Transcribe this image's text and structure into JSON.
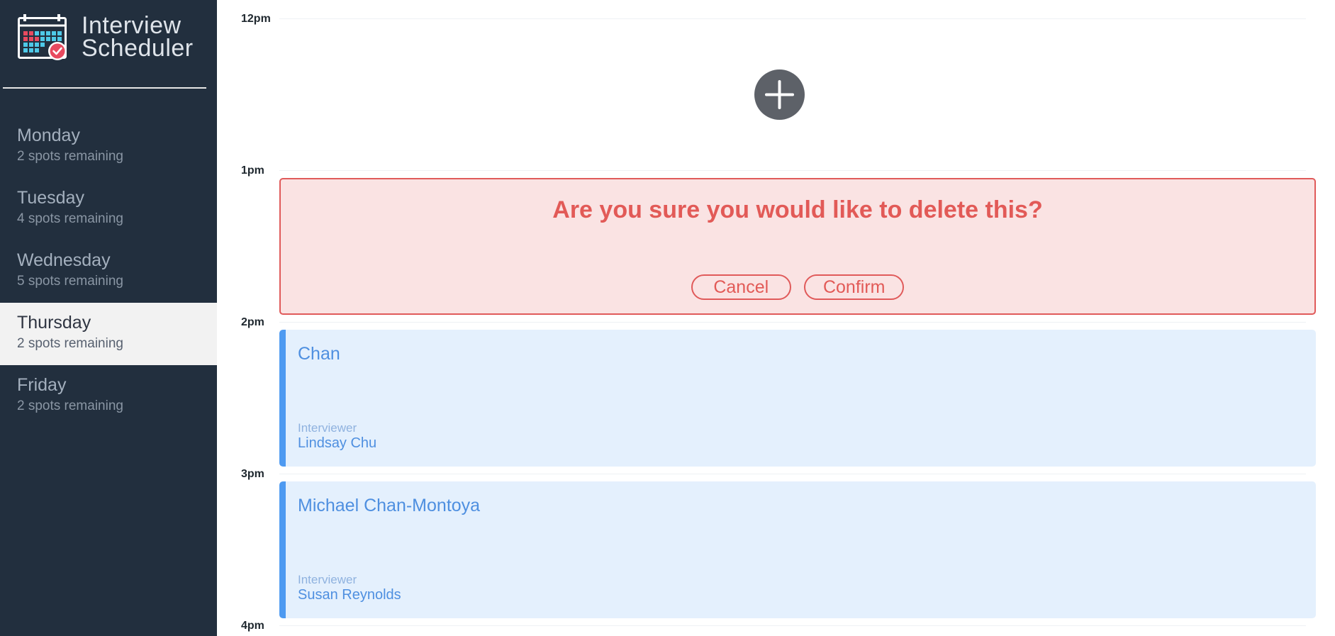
{
  "brand": {
    "title_line1": "Interview",
    "title_line2": "Scheduler",
    "logo_icon": "calendar-check-icon"
  },
  "days": [
    {
      "name": "Monday",
      "spots": "2 spots remaining",
      "selected": false
    },
    {
      "name": "Tuesday",
      "spots": "4 spots remaining",
      "selected": false
    },
    {
      "name": "Wednesday",
      "spots": "5 spots remaining",
      "selected": false
    },
    {
      "name": "Thursday",
      "spots": "2 spots remaining",
      "selected": true
    },
    {
      "name": "Friday",
      "spots": "2 spots remaining",
      "selected": false
    }
  ],
  "times": [
    "12pm",
    "1pm",
    "2pm",
    "3pm",
    "4pm"
  ],
  "add_button": {
    "icon": "plus-icon"
  },
  "confirm": {
    "message": "Are you sure you would like to delete this?",
    "cancel_label": "Cancel",
    "confirm_label": "Confirm"
  },
  "appointments": [
    {
      "student": "Chan",
      "interviewer_label": "Interviewer",
      "interviewer": "Lindsay Chu"
    },
    {
      "student": "Michael Chan-Montoya",
      "interviewer_label": "Interviewer",
      "interviewer": "Susan Reynolds"
    }
  ],
  "colors": {
    "sidebar_bg": "#222f3e",
    "selected_day_bg": "#f2f2f2",
    "danger": "#e05a5a",
    "danger_bg": "#fae3e3",
    "appointment_accent": "#4e9af1",
    "appointment_bg": "#e4f0fd"
  }
}
